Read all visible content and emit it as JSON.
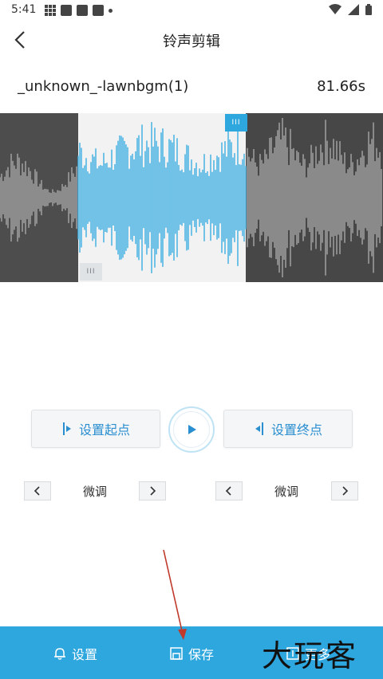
{
  "status_bar": {
    "time": "5:41"
  },
  "header": {
    "title": "铃声剪辑"
  },
  "file": {
    "name": "_unknown_-lawnbgm(1)",
    "duration": "81.66s"
  },
  "controls": {
    "set_start_label": "设置起点",
    "set_end_label": "设置终点"
  },
  "fine_tune": {
    "left_label": "微调",
    "right_label": "微调"
  },
  "bottom_bar": {
    "settings_label": "设置",
    "save_label": "保存",
    "more_label": "更多"
  },
  "watermark": "大玩客",
  "colors": {
    "accent": "#2ea6de",
    "waveform_dark_bg": "#4d4d4d",
    "waveform_light_bg": "#f2f2f2",
    "waveform_selected": "#3aaee2",
    "waveform_unselected": "#a7a7a7",
    "annotation_arrow": "#c0392b"
  }
}
